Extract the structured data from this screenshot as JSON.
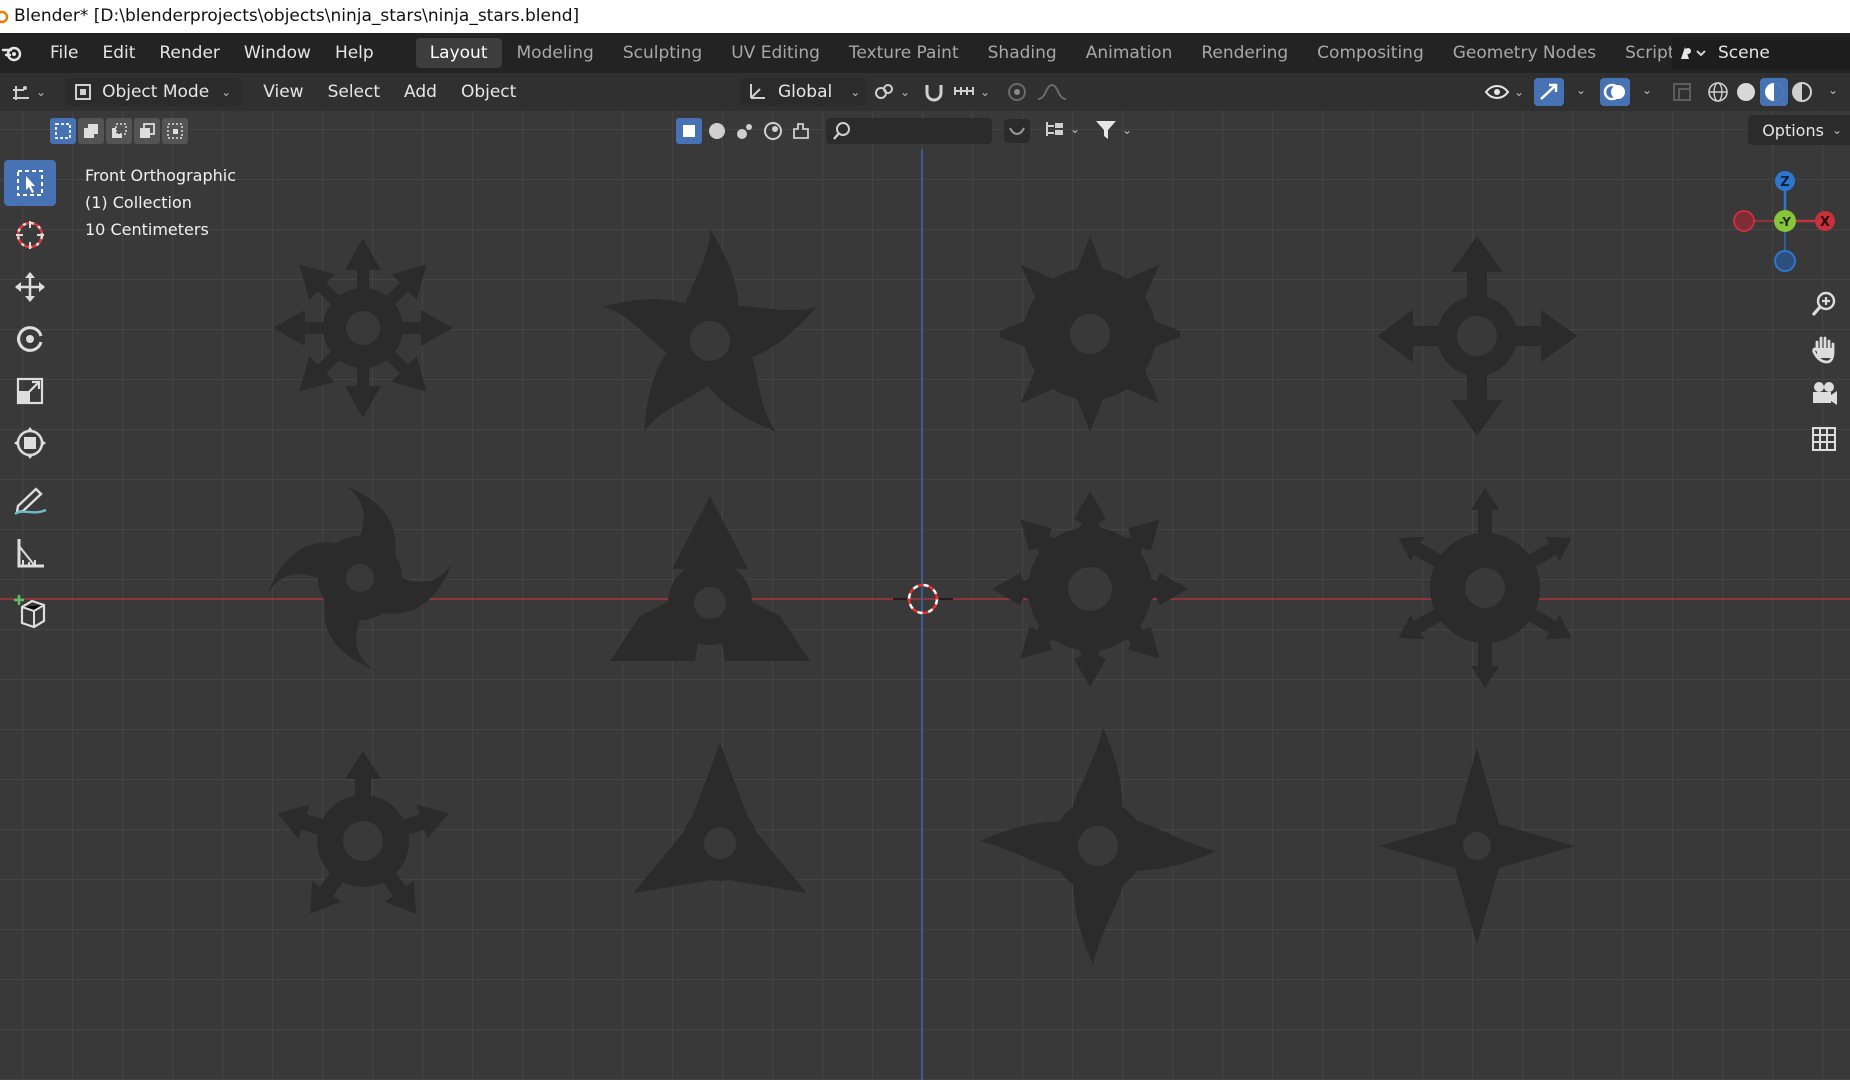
{
  "window": {
    "title": "Blender* [D:\\blenderprojects\\objects\\ninja_stars\\ninja_stars.blend]"
  },
  "menu": [
    "File",
    "Edit",
    "Render",
    "Window",
    "Help"
  ],
  "workspaces": [
    "Layout",
    "Modeling",
    "Sculpting",
    "UV Editing",
    "Texture Paint",
    "Shading",
    "Animation",
    "Rendering",
    "Compositing",
    "Geometry Nodes",
    "Scripting"
  ],
  "active_workspace": "Layout",
  "scene": {
    "name": "Scene"
  },
  "header": {
    "mode": "Object Mode",
    "menus": [
      "View",
      "Select",
      "Add",
      "Object"
    ],
    "transform_orientation": "Global"
  },
  "options_label": "Options",
  "viewport": {
    "view_name": "Front Orthographic",
    "collection": "(1) Collection",
    "scale": "10 Centimeters"
  },
  "gizmo": {
    "z": "Z",
    "y": "-Y",
    "x": "X"
  },
  "colors": {
    "accent": "#4772b3",
    "x_axis": "#c8303b",
    "y_axis": "#87c63b",
    "z_axis": "#2d77d1",
    "star_fill": "#2b2b2b"
  },
  "tools": [
    "select-box",
    "cursor",
    "move",
    "rotate",
    "scale",
    "transform",
    "annotate",
    "measure",
    "add-cube"
  ],
  "objects": [
    "star-1",
    "star-2",
    "star-3",
    "star-4",
    "star-5",
    "star-6",
    "star-7",
    "star-8",
    "star-9",
    "star-10",
    "star-11",
    "star-12"
  ]
}
